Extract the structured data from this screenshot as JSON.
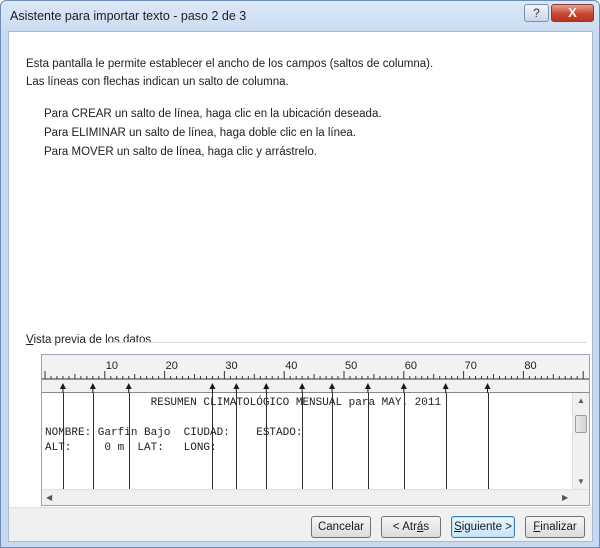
{
  "window": {
    "title": "Asistente para importar texto - paso 2 de 3",
    "help_glyph": "?",
    "close_glyph": "X"
  },
  "description": {
    "line1": "Esta pantalla le permite establecer el ancho de los campos (saltos de columna).",
    "line2": "Las líneas con flechas indican un salto de columna."
  },
  "instructions": [
    "Para CREAR un salto de línea, haga clic en la ubicación deseada.",
    "Para ELIMINAR un salto de línea, haga doble clic en la línea.",
    "Para MOVER un salto de línea, haga clic y arrástrelo."
  ],
  "preview": {
    "label_prefix": "V",
    "label_rest": "ista previa de los datos",
    "ruler_labels": [
      "10",
      "20",
      "30",
      "40",
      "50",
      "60",
      "70",
      "80"
    ],
    "lines": [
      "                RESUMEN CLIMATOLÓGICO MENSUAL para MAY. 2011",
      "",
      "NOMBRE: Garfin Bajo  CIUDAD:    ESTADO:",
      "ALT:     0 m  LAT:   LONG:"
    ],
    "column_breaks": [
      3,
      8,
      14,
      28,
      32,
      37,
      43,
      48,
      54,
      60,
      67,
      74
    ]
  },
  "buttons": {
    "cancel": "Cancelar",
    "back_prefix": "< Atr",
    "back_underline": "á",
    "back_suffix": "s",
    "next_underline": "S",
    "next_rest": "iguiente >",
    "finish_underline": "F",
    "finish_rest": "inalizar"
  },
  "icons": {
    "scroll_up": "▲",
    "scroll_down": "▼",
    "scroll_left": "◀",
    "scroll_right": "▶"
  }
}
